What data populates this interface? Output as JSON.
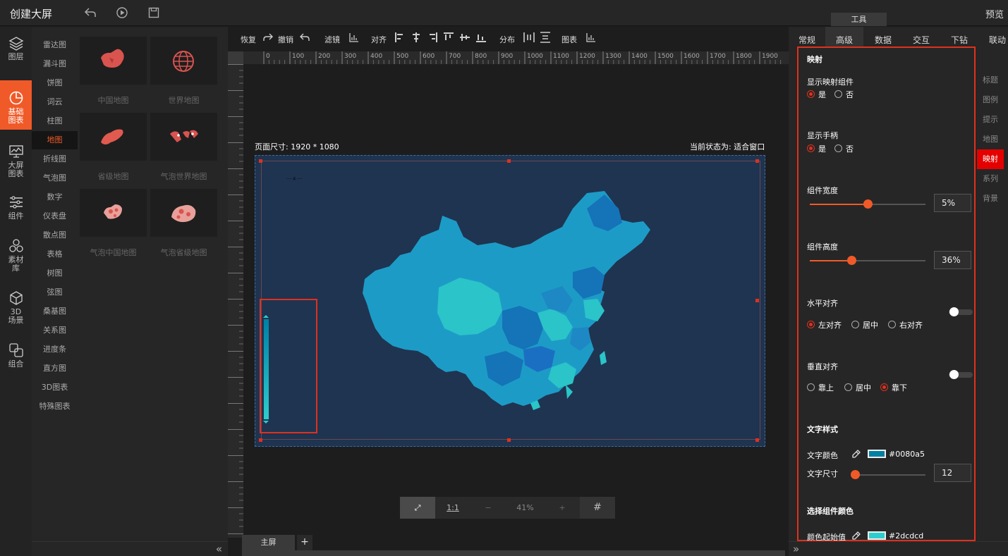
{
  "app": {
    "title": "创建大屏",
    "preview": "预览",
    "tool_tab": "工具"
  },
  "leftnav": [
    {
      "name": "layers",
      "label": "图层",
      "icon": "layers-icon"
    },
    {
      "name": "basic-charts",
      "label": "基础\n图表",
      "icon": "pie-chart-icon",
      "active": true
    },
    {
      "name": "big-screen-charts",
      "label": "大屏\n图表",
      "icon": "monitor-chart-icon"
    },
    {
      "name": "components",
      "label": "组件",
      "icon": "sliders-icon"
    },
    {
      "name": "assets",
      "label": "素材\n库",
      "icon": "hexagons-icon"
    },
    {
      "name": "3d-scene",
      "label": "3D\n场景",
      "icon": "cube-icon"
    },
    {
      "name": "group",
      "label": "组合",
      "icon": "group-icon"
    }
  ],
  "categories": [
    "雷达图",
    "漏斗图",
    "饼图",
    "词云",
    "柱图",
    "地图",
    "折线图",
    "气泡图",
    "数字",
    "仪表盘",
    "散点图",
    "表格",
    "树图",
    "弦图",
    "桑基图",
    "关系图",
    "进度条",
    "直方图",
    "3D图表",
    "特殊图表"
  ],
  "active_category": "地图",
  "thumbnails": [
    "中国地图",
    "世界地图",
    "省级地图",
    "气泡世界地图",
    "气泡中国地图",
    "气泡省级地图"
  ],
  "toolbar": {
    "redo": "恢复",
    "undo": "撤销",
    "filter": "滤镜",
    "align": "对齐",
    "distribute": "分布",
    "chart": "图表"
  },
  "ruler_labels": [
    "0",
    "100",
    "200",
    "300",
    "400",
    "500",
    "600",
    "700",
    "800",
    "900",
    "1000",
    "1100",
    "1200",
    "1300",
    "1400",
    "1500",
    "1600",
    "1700",
    "1800",
    "1900"
  ],
  "canvas": {
    "page_size": "页面尺寸: 1920 * 1080",
    "status": "当前状态为: 适合窗口",
    "legend_label": "—— 高 ——"
  },
  "zoom": {
    "fit": "⤢",
    "one_to_one": "1:1",
    "minus": "−",
    "value": "41%",
    "plus": "+",
    "grid": "#"
  },
  "screen_tab": {
    "label": "主屏",
    "add": "+"
  },
  "right_tabs": [
    "常规",
    "高级",
    "数据",
    "交互",
    "下钻",
    "联动"
  ],
  "right_active": "高级",
  "side_tabs": [
    "标题",
    "图例",
    "提示",
    "地图",
    "映射",
    "系列",
    "背景"
  ],
  "side_active": "映射",
  "props": {
    "section_title": "映射",
    "show_mapping": {
      "label": "显示映射组件",
      "yes": "是",
      "no": "否"
    },
    "show_handle": {
      "label": "显示手柄",
      "yes": "是",
      "no": "否"
    },
    "width": {
      "label": "组件宽度",
      "value": "5%",
      "level": 0.5
    },
    "height": {
      "label": "组件高度",
      "value": "36%",
      "level": 0.36
    },
    "h_align": {
      "label": "水平对齐",
      "left": "左对齐",
      "center": "居中",
      "right": "右对齐"
    },
    "v_align": {
      "label": "垂直对齐",
      "top": "靠上",
      "middle": "居中",
      "bottom": "靠下"
    },
    "text_style": "文字样式",
    "text_color": {
      "label": "文字颜色",
      "value": "#0080a5"
    },
    "text_size": {
      "label": "文字尺寸",
      "value": "12",
      "level": 0.0
    },
    "select_color": "选择组件颜色",
    "color_start": {
      "label": "颜色起始值",
      "value": "#2dcdcd"
    }
  }
}
